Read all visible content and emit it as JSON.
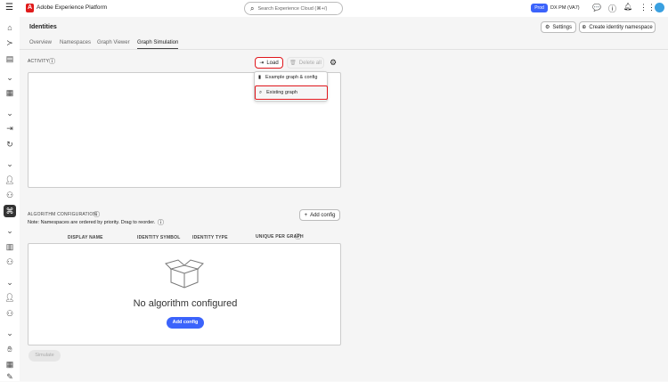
{
  "header": {
    "app_title": "Adobe Experience Platform",
    "search_placeholder": "Search Experience Cloud (⌘+/)",
    "env_badge": "Prod",
    "org": "DX PM (VA7)"
  },
  "page": {
    "title": "Identities",
    "settings_label": "Settings",
    "create_label": "Create identity namespace"
  },
  "tabs": [
    {
      "label": "Overview"
    },
    {
      "label": "Namespaces"
    },
    {
      "label": "Graph Viewer"
    },
    {
      "label": "Graph Simulation",
      "active": true
    }
  ],
  "activity": {
    "label": "ACTIVITY",
    "load_label": "Load",
    "delete_label": "Delete all"
  },
  "load_menu": {
    "items": [
      {
        "label": "Example graph & config"
      },
      {
        "label": "Existing graph"
      }
    ]
  },
  "algorithm": {
    "label": "ALGORITHM CONFIGURATION",
    "note": "Note: Namespaces are ordered by priority. Drag to reorder.",
    "add_label": "Add config",
    "columns": [
      "DISPLAY NAME",
      "IDENTITY SYMBOL",
      "IDENTITY TYPE",
      "UNIQUE PER GRAPH"
    ],
    "empty_text": "No algorithm configured",
    "empty_button": "Add config"
  },
  "simulate_label": "Simulate",
  "colors": {
    "accent": "#3b63fb",
    "highlight": "#e0161c"
  }
}
